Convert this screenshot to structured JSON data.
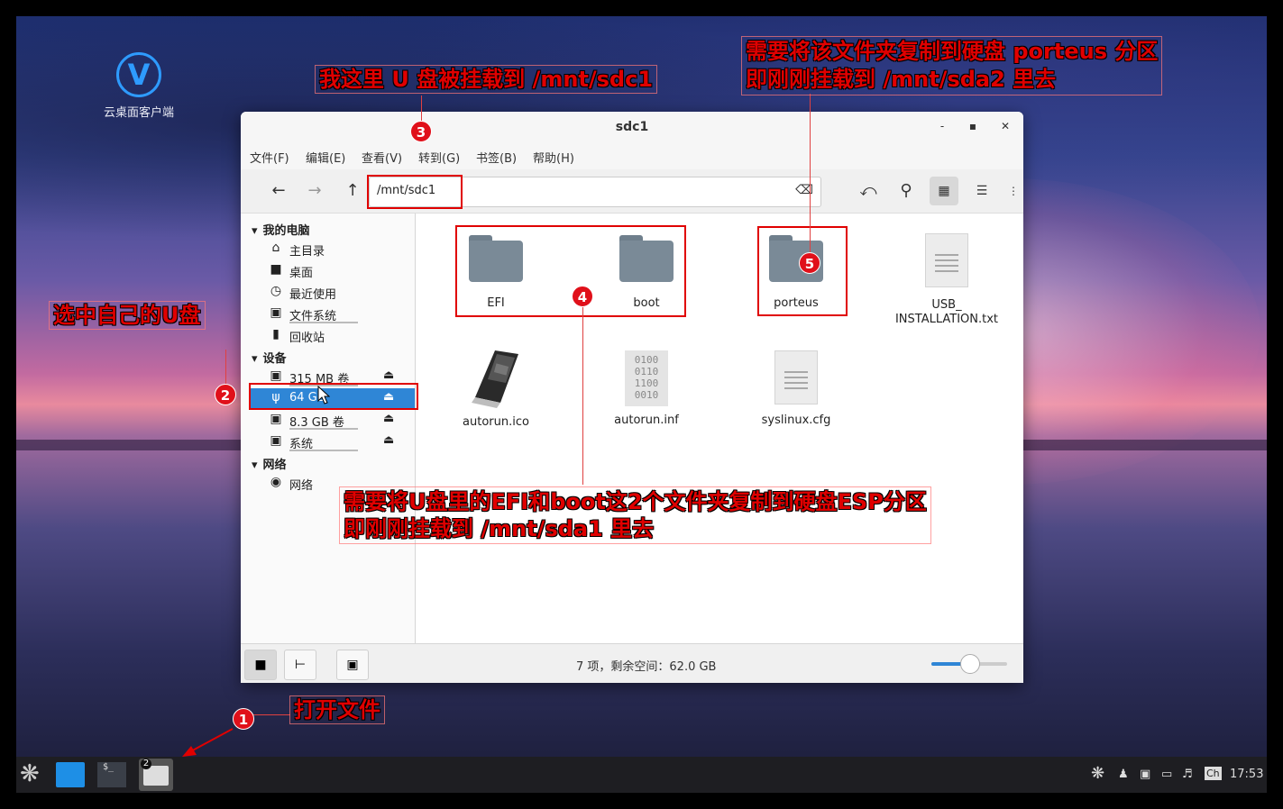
{
  "desktop": {
    "icon_label": "云桌面客户端",
    "icon_glyph": "V"
  },
  "window": {
    "title": "sdc1",
    "controls": {
      "minimize": "-",
      "maximize": "▪",
      "close": "✕"
    },
    "menu": [
      "文件(F)",
      "编辑(E)",
      "查看(V)",
      "转到(G)",
      "书签(B)",
      "帮助(H)"
    ],
    "address": "/mnt/sdc1"
  },
  "sidebar": {
    "my_computer": "我的电脑",
    "places": [
      "主目录",
      "桌面",
      "最近使用",
      "文件系统",
      "回收站"
    ],
    "devices_header": "设备",
    "devices": [
      "315 MB 卷",
      "64 GB",
      "8.3 GB 卷",
      "系统"
    ],
    "network_header": "网络",
    "network": [
      "网络"
    ]
  },
  "files": [
    {
      "name": "EFI",
      "type": "folder"
    },
    {
      "name": "boot",
      "type": "folder"
    },
    {
      "name": "porteus",
      "type": "folder"
    },
    {
      "name": "USB_\nINSTALLATION.txt",
      "type": "text"
    },
    {
      "name": "autorun.ico",
      "type": "image"
    },
    {
      "name": "autorun.inf",
      "type": "binary"
    },
    {
      "name": "syslinux.cfg",
      "type": "text"
    }
  ],
  "binary_preview": [
    "0100",
    "0110",
    "1100",
    "0010"
  ],
  "status": "7 项，剩余空间：62.0 GB",
  "zoom_level": 0.5,
  "taskbar": {
    "clock": "17:53",
    "ime": "Ch",
    "badge": "2"
  },
  "annotations": {
    "a1": "打开文件",
    "a2": "选中自己的U盘",
    "a3": "我这里 U 盘被挂载到 /mnt/sdc1",
    "a4_line1": "需要将U盘里的EFI和boot这2个文件夹复制到硬盘ESP分区",
    "a4_line2": "即刚刚挂载到 /mnt/sda1 里去",
    "a5_line1": "需要将该文件夹复制到硬盘 porteus 分区",
    "a5_line2": "即刚刚挂载到 /mnt/sda2 里去",
    "n1": "1",
    "n2": "2",
    "n3": "3",
    "n4": "4",
    "n5": "5"
  },
  "colors": {
    "accent": "#2f86d6",
    "annotation": "#e00000",
    "folder": "#7a8a97"
  }
}
